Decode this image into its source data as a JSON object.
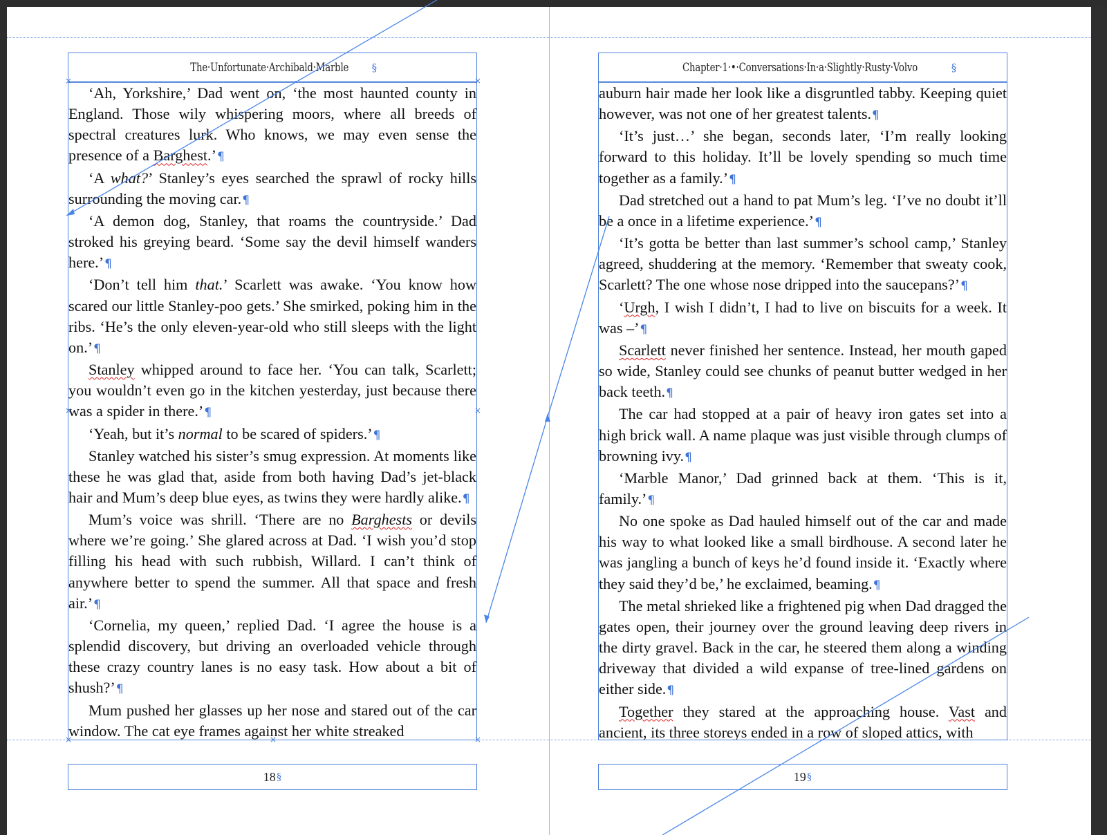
{
  "left_page": {
    "running_head": "The·Unfortunate·Archibald·Marble",
    "folio": "18",
    "paragraphs": [
      {
        "segments": [
          {
            "t": "‘Ah, Yorkshire,’ Dad went on, ‘the most haunted county in England. Those wily whispering moors, where all breeds of spectral creatures lurk. Who knows, we may even sense the presence of a "
          },
          {
            "t": "Barghest",
            "s": true
          },
          {
            "t": ".’"
          }
        ]
      },
      {
        "segments": [
          {
            "t": "‘A "
          },
          {
            "t": "what?",
            "i": true
          },
          {
            "t": "’ Stanley’s eyes searched the sprawl of rocky hills surrounding the moving car."
          }
        ]
      },
      {
        "segments": [
          {
            "t": "‘A demon dog, Stanley, that roams the countryside.’ Dad stroked his greying beard. ‘Some say the devil himself wanders here.’"
          }
        ]
      },
      {
        "segments": [
          {
            "t": "‘Don’t tell him "
          },
          {
            "t": "that.",
            "i": true
          },
          {
            "t": "’ Scarlett was awake. ‘You know how scared our little Stanley-poo gets.’ She smirked, poking him in the ribs. ‘He’s the only eleven-year-old who still sleeps with the light on.’"
          }
        ]
      },
      {
        "segments": [
          {
            "t": "Stanley",
            "s": true
          },
          {
            "t": " whipped around to face her. ‘You can talk, Scarlett; you wouldn’t even go in the kitchen yesterday, just because there was a spider in there.’"
          }
        ]
      },
      {
        "segments": [
          {
            "t": "‘Yeah, but it’s "
          },
          {
            "t": "normal",
            "i": true
          },
          {
            "t": " to be scared of spiders.’"
          }
        ]
      },
      {
        "segments": [
          {
            "t": "Stanley watched his sister’s smug expression. At moments like these he was glad that, aside from both having Dad’s jet-black hair and Mum’s deep blue eyes, as twins they were hardly alike."
          }
        ]
      },
      {
        "segments": [
          {
            "t": "Mum’s voice was shrill. ‘There are no "
          },
          {
            "t": "Barghests",
            "i": true,
            "s": true
          },
          {
            "t": " or devils where we’re going.’ She glared across at Dad. ‘I wish you’d stop filling his head with such rubbish, Willard. I can’t think of anywhere better to spend the summer. All that space and fresh air.’"
          }
        ]
      },
      {
        "segments": [
          {
            "t": "‘Cornelia, my queen,’ replied Dad. ‘I agree the house is a splendid discovery, but driving an overloaded vehicle through these crazy country lanes is no easy task. How about a bit of shush?’"
          }
        ]
      },
      {
        "segments": [
          {
            "t": "Mum pushed her glasses up her nose and stared out of the car window. The cat eye frames against her white streaked"
          }
        ],
        "nopilcrow": true
      }
    ]
  },
  "right_page": {
    "running_head": "Chapter·1·•·Conversations·In·a·Slightly·Rusty·Volvo",
    "folio": "19",
    "paragraphs": [
      {
        "cont": true,
        "segments": [
          {
            "t": "auburn hair made her look like a disgruntled tabby. Keeping quiet however, was not one of her greatest talents."
          }
        ]
      },
      {
        "segments": [
          {
            "t": "‘It’s just…’ she began, seconds later, ‘I’m really looking forward to this holiday. It’ll be lovely spending so much time together as a family.’"
          }
        ]
      },
      {
        "segments": [
          {
            "t": "Dad stretched out a hand to pat Mum’s leg. ‘I’ve no doubt it’ll be a once in a lifetime experience.’"
          }
        ]
      },
      {
        "segments": [
          {
            "t": "‘It’s gotta be better than last summer’s school camp,’ Stanley agreed, shuddering at the memory. ‘Remember that sweaty cook, Scarlett? The one whose nose dripped into the saucepans?’"
          }
        ]
      },
      {
        "segments": [
          {
            "t": "‘"
          },
          {
            "t": "Urgh",
            "s": true
          },
          {
            "t": ", I wish I didn’t, I had to live on biscuits for a week. It was –’"
          }
        ]
      },
      {
        "segments": [
          {
            "t": "Scarlett",
            "s": true
          },
          {
            "t": " never finished her sentence. Instead, her mouth gaped so wide, Stanley could see chunks of peanut butter wedged in her back teeth."
          }
        ]
      },
      {
        "segments": [
          {
            "t": "The car had stopped at a pair of heavy iron gates set into a high brick wall. A name plaque was just visible through clumps of browning ivy."
          }
        ]
      },
      {
        "segments": [
          {
            "t": "‘Marble Manor,’ Dad grinned back at them. ‘This is it, family.’"
          }
        ]
      },
      {
        "segments": [
          {
            "t": "No one spoke as Dad hauled himself out of the car and made his way to what looked like a small birdhouse. A second later he was jangling a bunch of keys he’d found inside it. ‘Exactly where they said they’d be,’ he exclaimed, beaming."
          }
        ]
      },
      {
        "segments": [
          {
            "t": "The metal shrieked like a frightened pig when Dad dragged the gates open, their journey over the ground leaving deep rivers in the dirty gravel. Back in the car, he steered them along a winding driveway that divided a wild expanse of tree-lined gardens on either side."
          }
        ]
      },
      {
        "segments": [
          {
            "t": "Together",
            "s": true
          },
          {
            "t": " they stared at the approaching house. "
          },
          {
            "t": "Vast",
            "s": true
          },
          {
            "t": " and ancient, its three storeys ended in a row of sloped attics, with"
          }
        ],
        "nopilcrow": true
      }
    ]
  },
  "icons": {
    "pilcrow": "¶",
    "link_glyph": "§",
    "handle": "×"
  }
}
